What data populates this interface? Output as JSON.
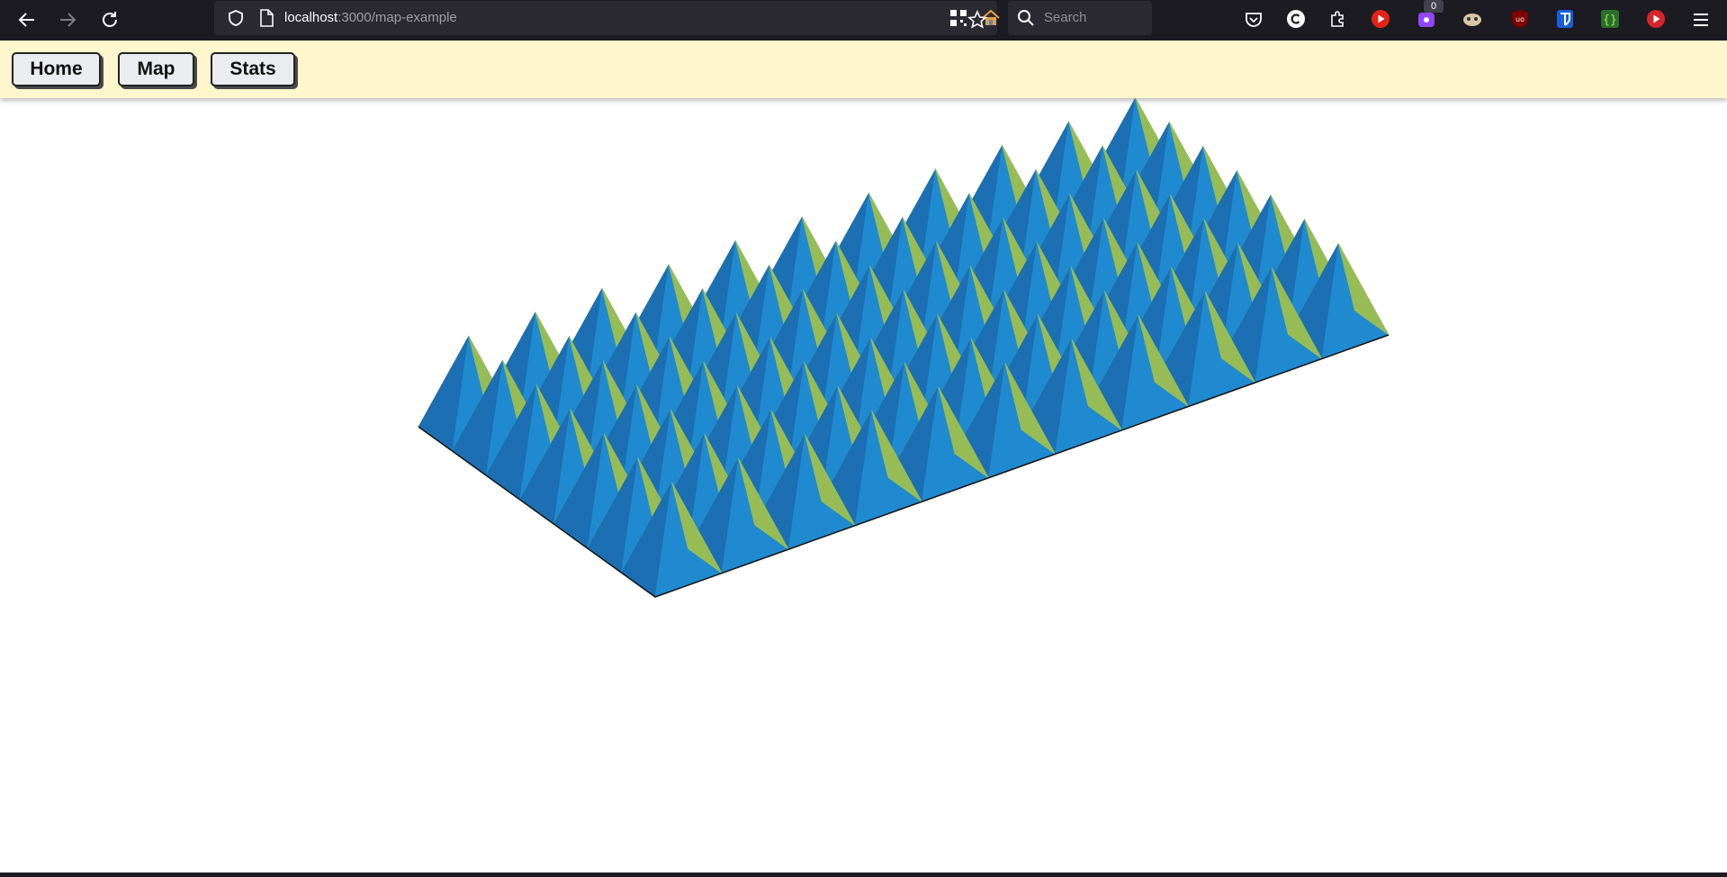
{
  "browser": {
    "url_host": "localhost",
    "url_path": ":3000/map-example",
    "search_placeholder": "Search",
    "extension_badge": "0"
  },
  "nav": {
    "home_label": "Home",
    "map_label": "Map",
    "stats_label": "Stats"
  },
  "map": {
    "rows": 7,
    "cols": 11,
    "colors": {
      "side_blue": "#1b6fb2",
      "side_blue_light": "#1f8ad0",
      "face_green": "#8fb24d",
      "face_green_light": "#97bc55",
      "face_green_dark": "#869f48",
      "edge_line": "#111111"
    }
  }
}
